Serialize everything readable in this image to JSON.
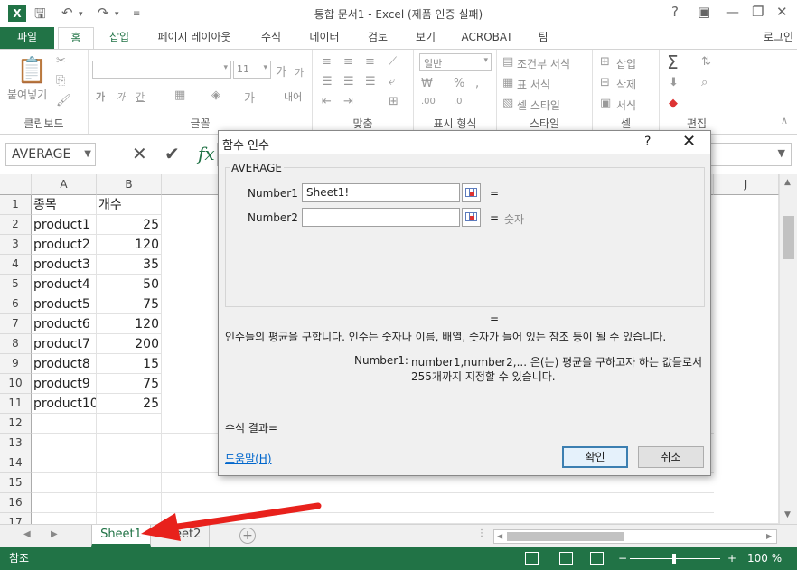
{
  "window": {
    "title": "통합 문서1 - Excel (제품 인증 실패)",
    "help_btn": "?",
    "login": "로그인"
  },
  "ribbon_tabs": [
    "파일",
    "홈",
    "삽입",
    "페이지 레이아웃",
    "수식",
    "데이터",
    "검토",
    "보기",
    "ACROBAT",
    "팀"
  ],
  "ribbon": {
    "paste_label": "붙여넣기",
    "font_size": "11",
    "number_format": "일반",
    "conditional_format": "조건부 서식",
    "table_format": "표 서식",
    "cell_style": "셀 스타일",
    "insert": "삽입",
    "delete": "삭제",
    "format": "서식",
    "wrap": "내어",
    "groups": [
      "클립보드",
      "글꼴",
      "맞춤",
      "표시 형식",
      "스타일",
      "셀",
      "편집"
    ]
  },
  "formula_bar": {
    "name_box": "AVERAGE",
    "cancel": "✕",
    "enter": "✔",
    "fx": "fx"
  },
  "grid": {
    "columns": [
      "A",
      "B",
      "J"
    ],
    "rows": [
      "1",
      "2",
      "3",
      "4",
      "5",
      "6",
      "7",
      "8",
      "9",
      "10",
      "11",
      "12",
      "13",
      "14",
      "15",
      "16",
      "17"
    ],
    "header": [
      "종목",
      "개수"
    ],
    "data": [
      [
        "product1",
        "25"
      ],
      [
        "product2",
        "120"
      ],
      [
        "product3",
        "35"
      ],
      [
        "product4",
        "50"
      ],
      [
        "product5",
        "75"
      ],
      [
        "product6",
        "120"
      ],
      [
        "product7",
        "200"
      ],
      [
        "product8",
        "15"
      ],
      [
        "product9",
        "75"
      ],
      [
        "product10",
        "25"
      ]
    ]
  },
  "sheets": {
    "active": "Sheet1",
    "other": "Sheet2"
  },
  "status": {
    "mode": "참조",
    "zoom": "100 %"
  },
  "dialog": {
    "title": "함수 인수",
    "help": "?",
    "close": "✕",
    "function_name": "AVERAGE",
    "arg1_label": "Number1",
    "arg1_value": "Sheet1!",
    "arg1_eq": "=",
    "arg2_label": "Number2",
    "arg2_value": "",
    "arg2_eq": "=",
    "arg2_hint": "숫자",
    "result_eq": "=",
    "description": "인수들의 평균을 구합니다. 인수는 숫자나 이름, 배열, 숫자가 들어 있는 참조 등이 될 수 있습니다.",
    "arg_help_label": "Number1:",
    "arg_help_line1": "number1,number2,... 은(는) 평균을 구하고자 하는 값들로서",
    "arg_help_line2": "255개까지 지정할 수 있습니다.",
    "formula_result": "수식 결과=",
    "help_link": "도움말(H)",
    "ok": "확인",
    "cancel": "취소"
  },
  "colors": {
    "excel_green": "#217346",
    "annotation_arrow": "#e8211c"
  }
}
